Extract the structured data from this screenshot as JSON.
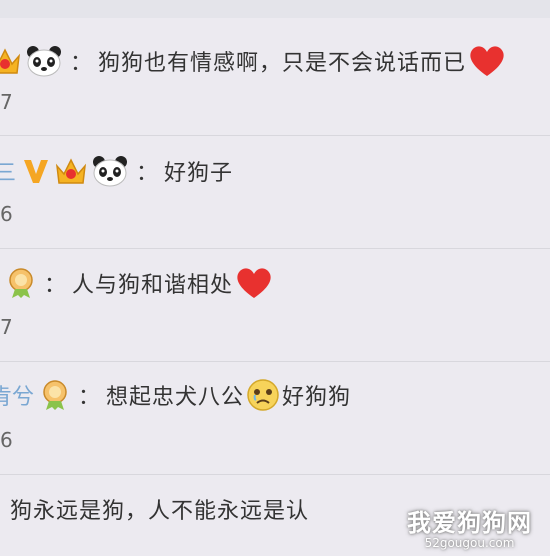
{
  "comments": [
    {
      "user": "",
      "text": "狗狗也有情感啊，只是不会说话而已",
      "meta": "7"
    },
    {
      "user": "三",
      "text": "好狗子",
      "meta": "6"
    },
    {
      "user": "",
      "text": "人与狗和谐相处",
      "meta": "7"
    },
    {
      "user": "肯兮",
      "text": "想起忠犬八公",
      "text2": "好狗狗",
      "meta": "6"
    },
    {
      "user": "",
      "text": "狗永远是狗，人不能永远是认",
      "meta": ""
    }
  ],
  "colon": "：",
  "watermark": {
    "title": "我爱狗狗网",
    "url": "52gougou.com"
  },
  "colors": {
    "username": "#7aa7d2",
    "vip_v": "#f5a623",
    "heart": "#e8312f"
  }
}
